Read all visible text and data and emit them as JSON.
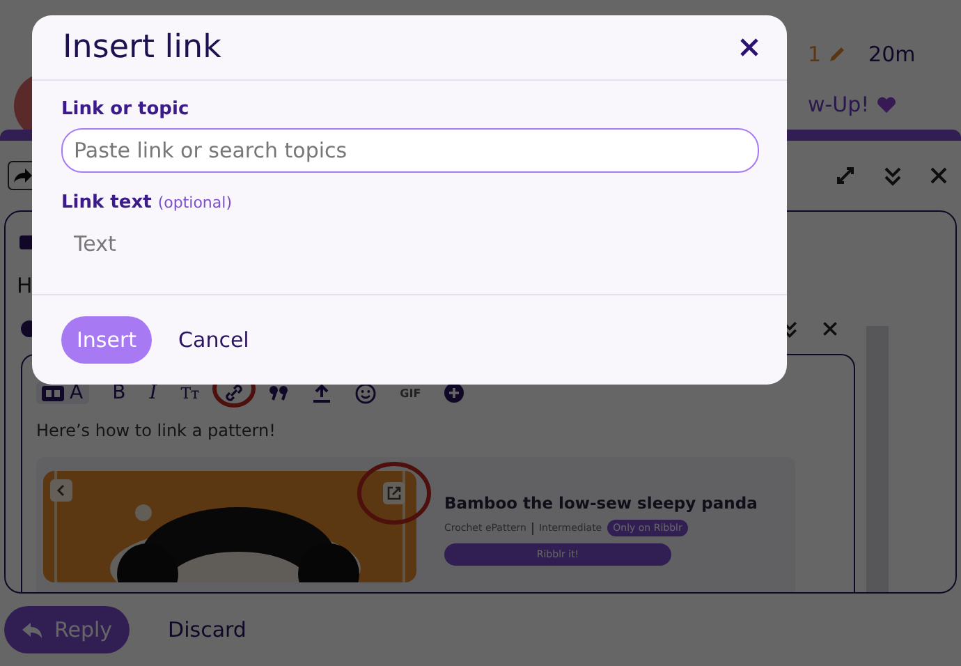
{
  "post": {
    "edit_count": "1",
    "age": "20m",
    "text_fragment": "w-Up!"
  },
  "composer": {
    "embedded": {
      "line_fragment": "H",
      "format_buttons": [
        "A",
        "B",
        "I",
        "Tт"
      ],
      "gif_label": "GIF",
      "body_text": "Here’s how to link a pattern!",
      "card": {
        "title": "Bamboo the low-sew sleepy panda",
        "type": "Crochet ePattern",
        "difficulty": "Intermediate",
        "badge": "Only on Ribblr",
        "button": "Ribblr it!"
      }
    }
  },
  "actions": [
    {
      "label": "Reply",
      "kind": "primary"
    },
    {
      "label": "Discard",
      "kind": "plain"
    }
  ],
  "modal": {
    "title": "Insert link",
    "fields": [
      {
        "label": "Link or topic",
        "placeholder": "Paste link or search topics",
        "focused": true
      },
      {
        "label": "Link text",
        "hint": "(optional)",
        "placeholder": "Text",
        "focused": false
      }
    ],
    "buttons": [
      {
        "label": "Insert",
        "kind": "primary"
      },
      {
        "label": "Cancel",
        "kind": "plain"
      }
    ]
  }
}
